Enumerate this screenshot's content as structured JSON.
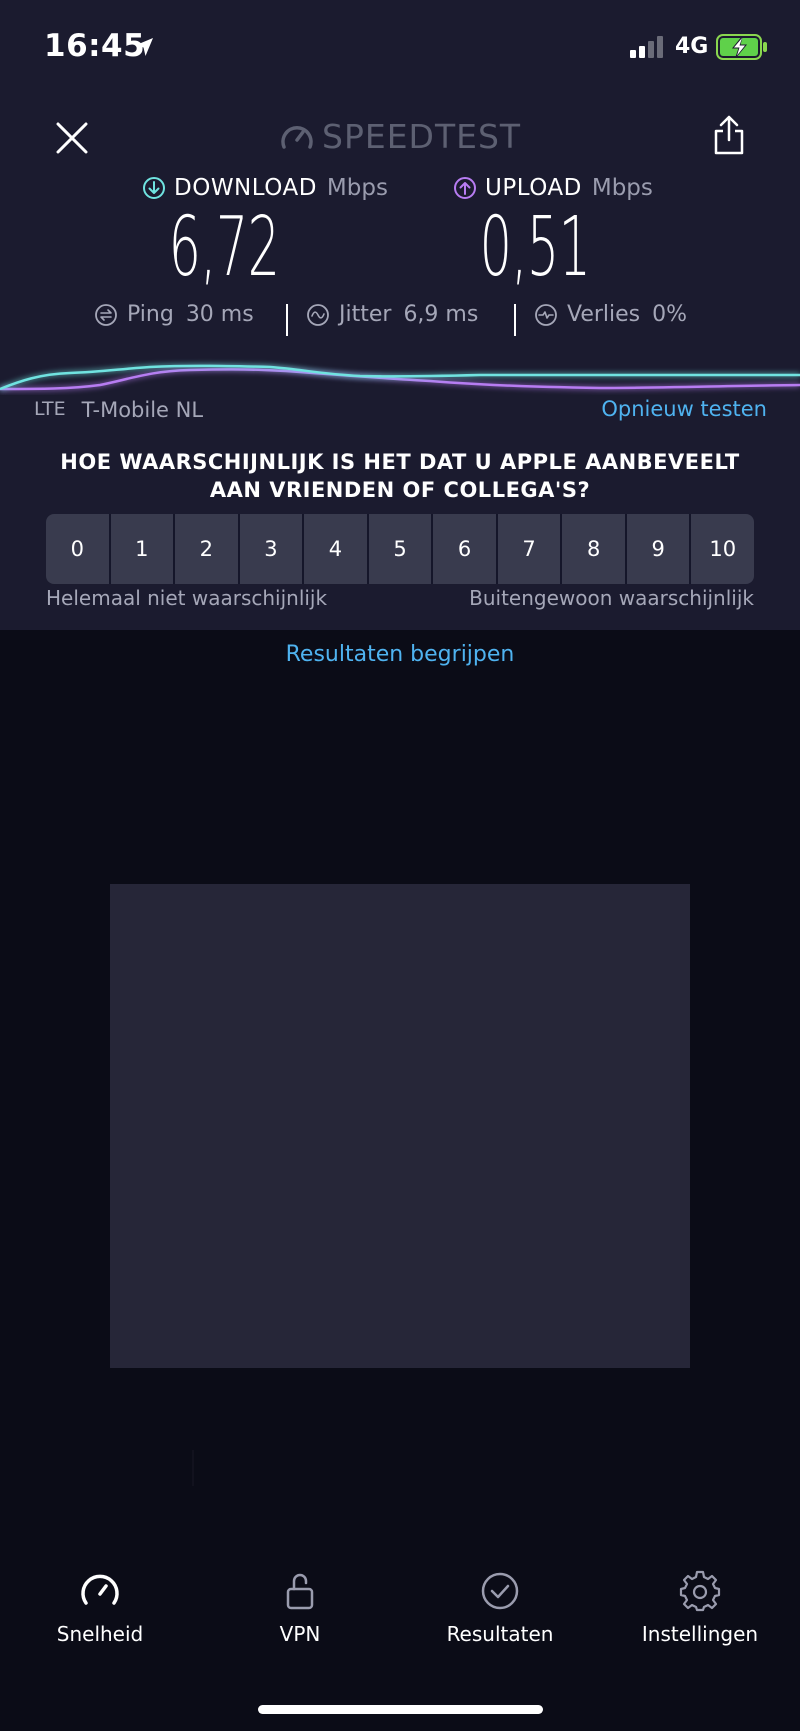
{
  "status_bar": {
    "time": "16:45",
    "network": "4G"
  },
  "header": {
    "logo_text": "SPEEDTEST"
  },
  "download": {
    "label": "DOWNLOAD",
    "unit": "Mbps",
    "value": "6,72"
  },
  "upload": {
    "label": "UPLOAD",
    "unit": "Mbps",
    "value": "0,51"
  },
  "stats": {
    "ping": {
      "label": "Ping",
      "value": "30 ms"
    },
    "jitter": {
      "label": "Jitter",
      "value": "6,9 ms"
    },
    "loss": {
      "label": "Verlies",
      "value": "0%"
    }
  },
  "carrier": {
    "tech": "LTE",
    "name": "T-Mobile NL"
  },
  "retest_label": "Opnieuw testen",
  "survey": {
    "question": "HOE WAARSCHIJNLIJK IS HET DAT U APPLE AANBEVEELT AAN VRIENDEN OF COLLEGA'S?",
    "options": [
      "0",
      "1",
      "2",
      "3",
      "4",
      "5",
      "6",
      "7",
      "8",
      "9",
      "10"
    ],
    "low_label": "Helemaal niet waarschijnlijk",
    "high_label": "Buitengewoon waarschijnlijk"
  },
  "understand_label": "Resultaten begrijpen",
  "tabs": [
    {
      "label": "Snelheid",
      "icon": "speedometer-icon"
    },
    {
      "label": "VPN",
      "icon": "lock-open-icon"
    },
    {
      "label": "Resultaten",
      "icon": "check-circle-icon"
    },
    {
      "label": "Instellingen",
      "icon": "gear-icon"
    }
  ],
  "colors": {
    "background": "#0b0c17",
    "panel": "#1b1b2f",
    "download_accent": "#6fe3e0",
    "upload_accent": "#b77cf2",
    "link": "#4fb3f0"
  }
}
